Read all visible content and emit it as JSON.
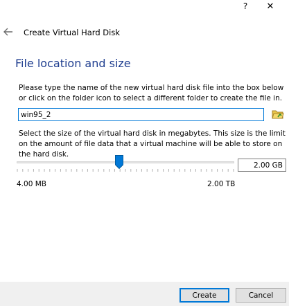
{
  "titlebar": {
    "help_label": "?",
    "close_label": "✕"
  },
  "header": {
    "back_icon": "back-arrow-icon",
    "title": "Create Virtual Hard Disk"
  },
  "section": {
    "heading": "File location and size"
  },
  "location": {
    "description": "Please type the name of the new virtual hard disk file into the box below or click on the folder icon to select a different folder to create the file in.",
    "filename_value": "win95_2",
    "folder_icon": "folder-icon"
  },
  "size": {
    "description": "Select the size of the virtual hard disk in megabytes. This size is the limit on the amount of file data that a virtual machine will be able to store on the hard disk.",
    "value_text": "2.00 GB",
    "slider_fraction": 0.47,
    "min_label": "4.00 MB",
    "max_label": "2.00 TB"
  },
  "buttons": {
    "create": "Create",
    "cancel": "Cancel"
  },
  "colors": {
    "heading": "#1e3d8f",
    "accent": "#0078d7",
    "footer_bg": "#f0f0f0"
  }
}
